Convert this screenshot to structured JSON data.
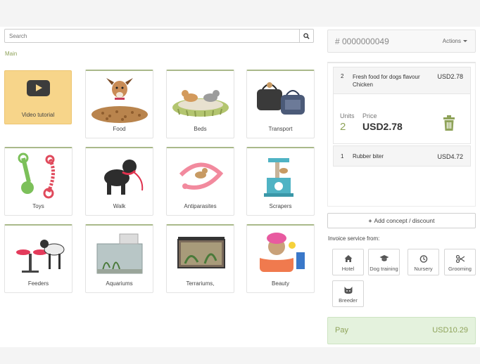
{
  "search": {
    "placeholder": "Search"
  },
  "breadcrumb": "Main",
  "categories": [
    {
      "label": "Video tutorial"
    },
    {
      "label": "Food"
    },
    {
      "label": "Beds"
    },
    {
      "label": "Transport"
    },
    {
      "label": "Toys"
    },
    {
      "label": "Walk"
    },
    {
      "label": "Antiparasites"
    },
    {
      "label": "Scrapers"
    },
    {
      "label": "Feeders"
    },
    {
      "label": "Aquariums"
    },
    {
      "label": "Terrariums,"
    },
    {
      "label": "Beauty"
    }
  ],
  "ticket": {
    "number": "# 0000000049",
    "actions_label": "Actions",
    "lines": [
      {
        "qty": "2",
        "description": "Fresh food for dogs flavour Chicken",
        "price": "USD2.78"
      },
      {
        "qty": "1",
        "description": "Rubber biter",
        "price": "USD4.72"
      }
    ],
    "editor": {
      "units_label": "Units",
      "units_value": "2",
      "price_label": "Price",
      "price_value": "USD2.78"
    }
  },
  "add_concept_label": "Add concept / discount",
  "invoice_service_label": "Invoice service from:",
  "services": [
    {
      "label": "Hotel",
      "icon": "home-icon"
    },
    {
      "label": "Dog training",
      "icon": "graduation-cap-icon"
    },
    {
      "label": "Nursery",
      "icon": "clock-icon"
    },
    {
      "label": "Grooming",
      "icon": "scissors-icon"
    },
    {
      "label": "Breeder",
      "icon": "cat-icon"
    }
  ],
  "pay": {
    "label": "Pay",
    "amount": "USD10.29"
  },
  "colors": {
    "accent": "#8fa35a",
    "video_tile": "#f7d58a",
    "pay_bg": "#e4f2dd"
  }
}
